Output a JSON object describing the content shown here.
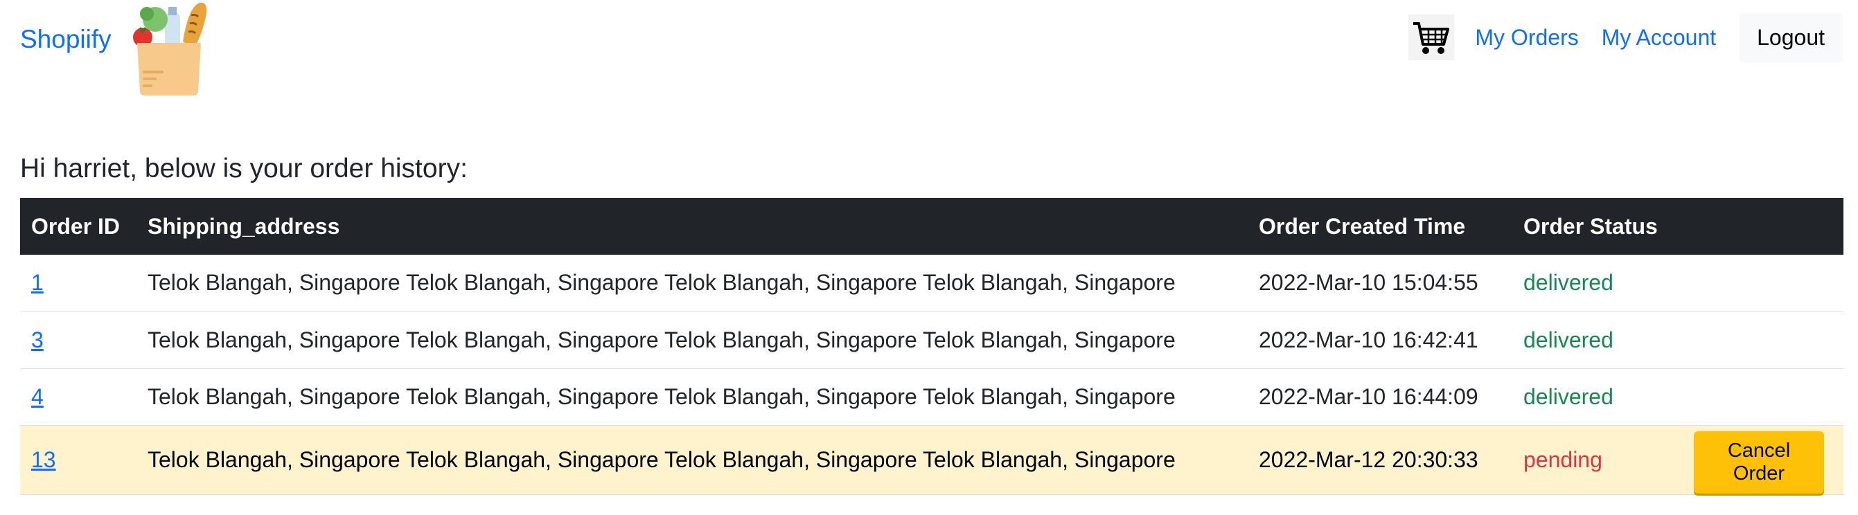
{
  "header": {
    "brand": "Shopiify",
    "nav": {
      "cart_icon": "shopping-cart-icon",
      "my_orders": "My Orders",
      "my_account": "My Account",
      "logout": "Logout"
    }
  },
  "greeting": "Hi harriet, below is your order history:",
  "table": {
    "headers": [
      "Order ID",
      "Shipping_address",
      "Order Created Time",
      "Order Status"
    ],
    "rows": [
      {
        "id": "1",
        "address": "Telok Blangah, Singapore Telok Blangah, Singapore Telok Blangah, Singapore Telok Blangah, Singapore",
        "created": "2022-Mar-10 15:04:55",
        "status": "delivered"
      },
      {
        "id": "3",
        "address": "Telok Blangah, Singapore Telok Blangah, Singapore Telok Blangah, Singapore Telok Blangah, Singapore",
        "created": "2022-Mar-10 16:42:41",
        "status": "delivered"
      },
      {
        "id": "4",
        "address": "Telok Blangah, Singapore Telok Blangah, Singapore Telok Blangah, Singapore Telok Blangah, Singapore",
        "created": "2022-Mar-10 16:44:09",
        "status": "delivered"
      },
      {
        "id": "13",
        "address": "Telok Blangah, Singapore Telok Blangah, Singapore Telok Blangah, Singapore Telok Blangah, Singapore",
        "created": "2022-Mar-12 20:30:33",
        "status": "pending",
        "action": "Cancel Order"
      }
    ]
  },
  "colors": {
    "link": "#0d6efd",
    "header_bg": "#212529",
    "delivered": "#198754",
    "pending": "#dc3545",
    "pending_row_bg": "#fff3cd",
    "cancel_button": "#ffc107"
  }
}
